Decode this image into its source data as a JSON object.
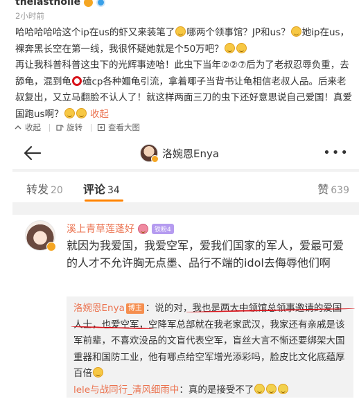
{
  "post": {
    "author": "thelastholle",
    "time": "2小时前",
    "body_parts": [
      "哈哈哈哈哈这个ip在us的虾又来装笔了",
      "哪两个领事馆？JP和us？",
      "她ip在us，裸奔黑长空在第一线，我很怀疑她就是个50万吧？",
      "再让我科普科普这虫下的光辉事迹哈！此虫下当年②②⑦后为了老叔忍辱负重，去舔龟，混到龟",
      "磕cp各种媚龟引流，拿着㖿子当背书让龟相信老叔人品。后来老叔复出，又立马翻脸不认人了！就这样两面三刀的虫下还好意思说自己爱国！真爱国跑us啊？",
      "收起"
    ],
    "tools": {
      "collapse": "收起",
      "rotate": "旋转",
      "view_large": "查看大图"
    }
  },
  "shot": {
    "header_title": "洛婉恩Enya",
    "more": "•••",
    "tabs": {
      "repost_label": "转发",
      "repost_count": "20",
      "comment_label": "评论",
      "comment_count": "34",
      "like_label": "赞",
      "like_count": "639"
    },
    "comment": {
      "name": "溪上青草莲蓬好",
      "fan_badge": "铁粉4",
      "text": "就因为我爱国，我爱空军，爱我们国家的军人，爱最可爱的人才不允许胸无点墨、品行不端的idol去侮辱他们啊"
    },
    "reply": {
      "name": "洛婉恩Enya",
      "host_badge": "博主",
      "text_lead": "：说的对，",
      "text_underlined": "我也是两大中领馆总领事邀请的爱国人士",
      "text_rest": "，也爱空军，空降军总部就在我老家武汉，我家还有亲戚是该军前辈，不喜欢没品的文盲代表空军，盲丝大言不惭还要绑架大国重器和国防工业，他有哪点给空军增光添彩吗，脸皮比文化底蕴厚百倍",
      "second_name": "lele与战同行_清风细雨中",
      "second_text": "：真的是接受不了"
    }
  },
  "colors": {
    "accent_orange": "#ff8200",
    "link": "#eb7350",
    "underline_red": "#d8131a"
  }
}
